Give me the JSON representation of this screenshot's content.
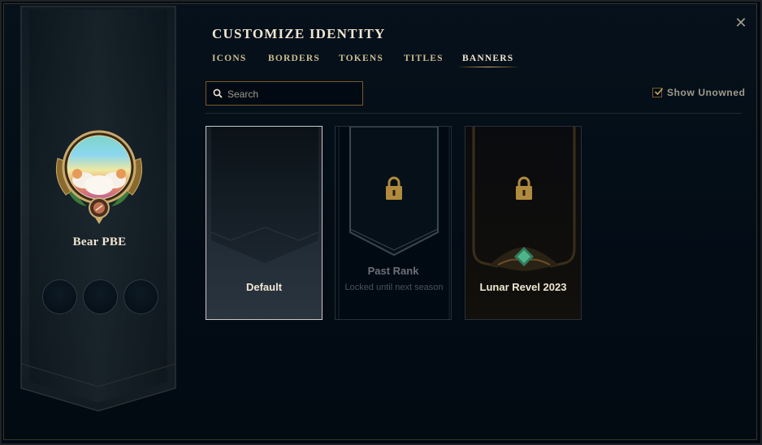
{
  "window": {
    "title": "CUSTOMIZE IDENTITY",
    "close_glyph": "✕"
  },
  "profile": {
    "summoner_name": "Bear PBE",
    "icon": "summoner-icon"
  },
  "tabs": [
    {
      "label": "ICONS",
      "active": false
    },
    {
      "label": "BORDERS",
      "active": false
    },
    {
      "label": "TOKENS",
      "active": false
    },
    {
      "label": "TITLES",
      "active": false
    },
    {
      "label": "BANNERS",
      "active": true
    }
  ],
  "search": {
    "placeholder": "Search",
    "value": ""
  },
  "filter": {
    "label": "Show Unowned",
    "checked": true
  },
  "banners": [
    {
      "title": "Default",
      "subtitle": "",
      "locked": false,
      "selected": true
    },
    {
      "title": "Past Rank",
      "subtitle": "Locked until next season",
      "locked": true,
      "selected": false
    },
    {
      "title": "Lunar Revel 2023",
      "subtitle": "",
      "locked": true,
      "selected": false
    }
  ],
  "colors": {
    "gold": "#c8aa6e",
    "gold_dark": "#785a28",
    "text_light": "#f0e6d2",
    "text_muted": "#a09b8c",
    "background": "#010a13"
  }
}
